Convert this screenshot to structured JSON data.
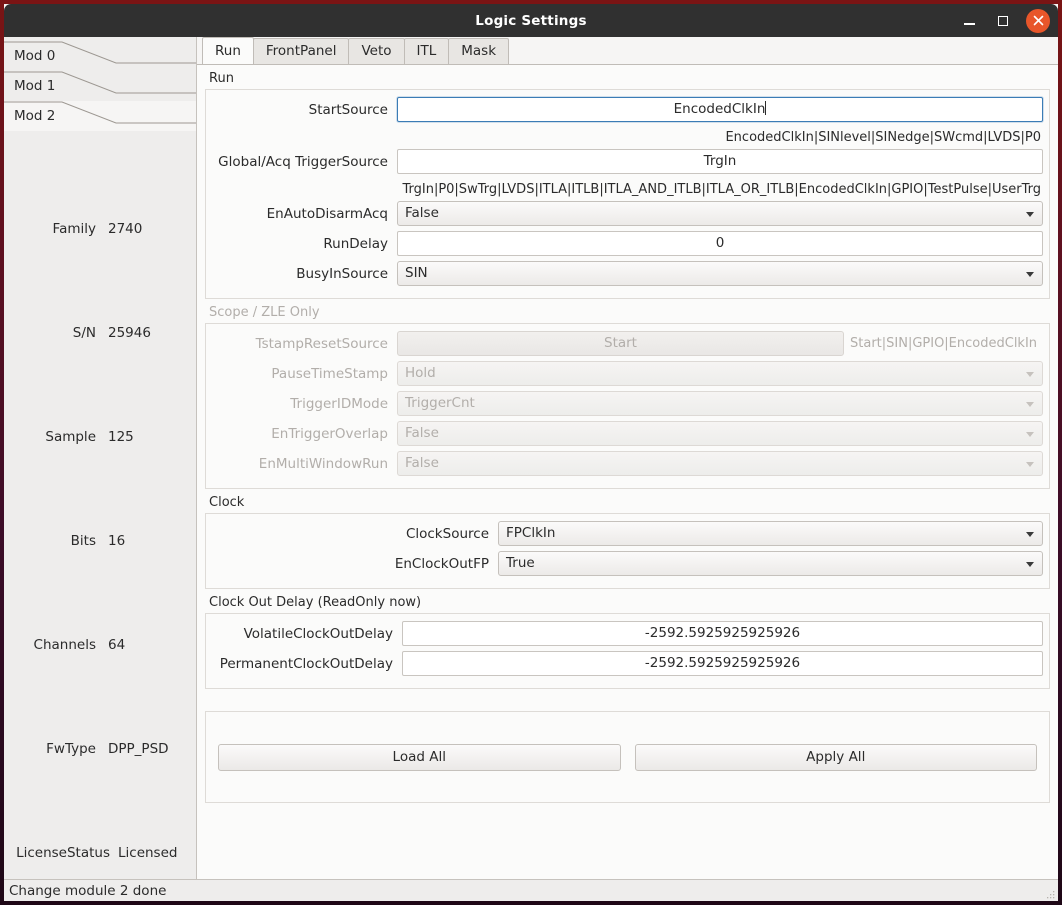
{
  "window": {
    "title": "Logic Settings",
    "controls": {
      "minimize": "minimize-icon",
      "maximize": "maximize-icon",
      "close": "close-icon"
    }
  },
  "sidebar": {
    "module_tabs": [
      {
        "label": "Mod 0",
        "selected": false
      },
      {
        "label": "Mod 1",
        "selected": false
      },
      {
        "label": "Mod 2",
        "selected": true
      }
    ],
    "info": [
      {
        "label": "Family",
        "value": "2740"
      },
      {
        "label": "S/N",
        "value": "25946"
      },
      {
        "label": "Sample",
        "value": "125"
      },
      {
        "label": "Bits",
        "value": "16"
      },
      {
        "label": "Channels",
        "value": "64"
      },
      {
        "label": "FwType",
        "value": "DPP_PSD"
      },
      {
        "label": "LicenseStatus",
        "value": "Licensed"
      }
    ]
  },
  "tabs": [
    {
      "label": "Run",
      "active": true
    },
    {
      "label": "FrontPanel",
      "active": false
    },
    {
      "label": "Veto",
      "active": false
    },
    {
      "label": "ITL",
      "active": false
    },
    {
      "label": "Mask",
      "active": false
    }
  ],
  "groups": {
    "run": {
      "title": "Run",
      "fields": {
        "start_source": {
          "label": "StartSource",
          "value": "EncodedClkIn",
          "hint": "EncodedClkIn|SINlevel|SINedge|SWcmd|LVDS|P0"
        },
        "trigger_source": {
          "label": "Global/Acq TriggerSource",
          "value": "TrgIn",
          "hint": "TrgIn|P0|SwTrg|LVDS|ITLA|ITLB|ITLA_AND_ITLB|ITLA_OR_ITLB|EncodedClkIn|GPIO|TestPulse|UserTrg"
        },
        "en_auto_disarm_acq": {
          "label": "EnAutoDisarmAcq",
          "value": "False"
        },
        "run_delay": {
          "label": "RunDelay",
          "value": "0"
        },
        "busy_in_source": {
          "label": "BusyInSource",
          "value": "SIN"
        }
      }
    },
    "scope_zle": {
      "title": "Scope / ZLE Only",
      "fields": {
        "tstamp_reset_source": {
          "label": "TstampResetSource",
          "value": "Start",
          "hint": "Start|SIN|GPIO|EncodedClkIn"
        },
        "pause_time_stamp": {
          "label": "PauseTimeStamp",
          "value": "Hold"
        },
        "trigger_id_mode": {
          "label": "TriggerIDMode",
          "value": "TriggerCnt"
        },
        "en_trigger_overlap": {
          "label": "EnTriggerOverlap",
          "value": "False"
        },
        "en_multi_window_run": {
          "label": "EnMultiWindowRun",
          "value": "False"
        }
      }
    },
    "clock": {
      "title": "Clock",
      "fields": {
        "clock_source": {
          "label": "ClockSource",
          "value": "FPClkIn"
        },
        "en_clock_out_fp": {
          "label": "EnClockOutFP",
          "value": "True"
        }
      }
    },
    "clock_out_delay": {
      "title": "Clock Out Delay (ReadOnly now)",
      "fields": {
        "volatile": {
          "label": "VolatileClockOutDelay",
          "value": "-2592.5925925925926"
        },
        "permanent": {
          "label": "PermanentClockOutDelay",
          "value": "-2592.5925925925926"
        }
      }
    }
  },
  "actions": {
    "load_all": "Load All",
    "apply_all": "Apply All"
  },
  "statusbar": {
    "message": "Change module 2 done"
  },
  "colors": {
    "accent_focus": "#3b7cb5",
    "close_button": "#e8562a",
    "titlebar": "#303030",
    "disabled_text": "#b2aeaa"
  }
}
